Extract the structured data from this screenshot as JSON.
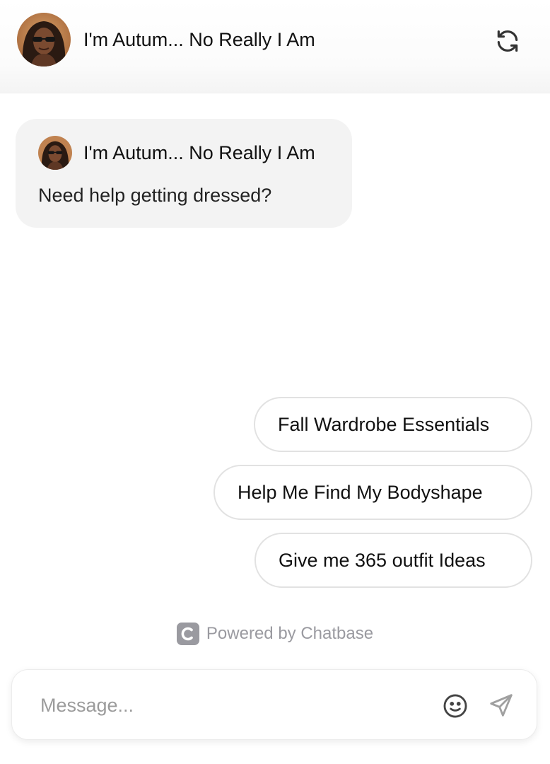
{
  "header": {
    "title": "I'm Autum... No Really I Am",
    "avatar_icon": "profile-photo-woman-sunglasses",
    "refresh_icon": "refresh-icon"
  },
  "messages": [
    {
      "sender": "I'm Autum... No Really I Am",
      "text": "Need help getting dressed?"
    }
  ],
  "suggestions": [
    "Fall Wardrobe Essentials",
    "Help Me Find My Bodyshape",
    "Give me 365 outfit Ideas"
  ],
  "footer": {
    "powered_by": "Powered by Chatbase",
    "logo_letter": "C"
  },
  "composer": {
    "placeholder": "Message...",
    "value": "",
    "emoji_icon": "smiley-icon",
    "send_icon": "send-icon"
  },
  "colors": {
    "bubble_bg": "#f3f3f3",
    "suggestion_border": "#e2e2e2",
    "muted_text": "#9a9aa0",
    "text": "#111111"
  }
}
